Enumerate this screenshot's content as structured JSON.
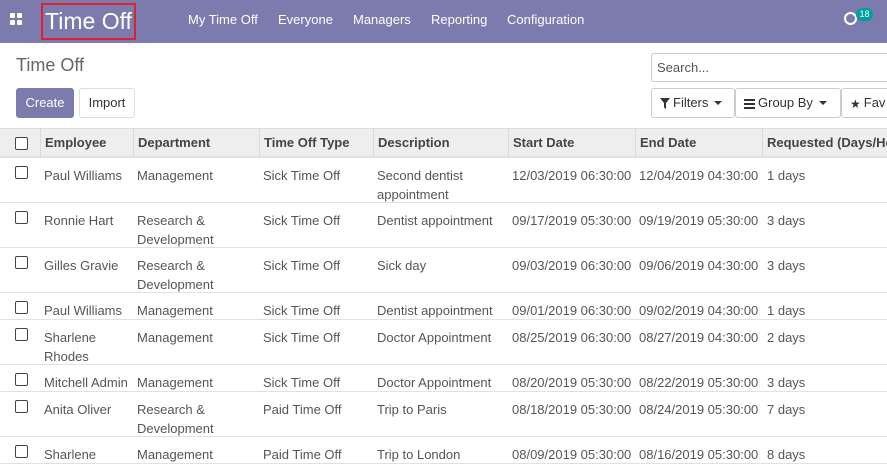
{
  "navbar": {
    "brand": "Time Off",
    "menu": [
      "My Time Off",
      "Everyone",
      "Managers",
      "Reporting",
      "Configuration"
    ],
    "activity_count": "18",
    "color": "#7c7bad"
  },
  "control_panel": {
    "title": "Time Off",
    "create_label": "Create",
    "import_label": "Import",
    "search_placeholder": "Search...",
    "filters_label": "Filters",
    "groupby_label": "Group By",
    "favorites_label": "Fav"
  },
  "table": {
    "columns": [
      "Employee",
      "Department",
      "Time Off Type",
      "Description",
      "Start Date",
      "End Date",
      "Requested (Days/Ho"
    ],
    "rows": [
      {
        "employee": [
          "Paul Williams"
        ],
        "department": [
          "Management"
        ],
        "type": "Sick Time Off",
        "description": [
          "Second dentist",
          "appointment"
        ],
        "start": "12/03/2019 06:30:00",
        "end": "12/04/2019 04:30:00",
        "requested": "1 days"
      },
      {
        "employee": [
          "Ronnie Hart"
        ],
        "department": [
          "Research &",
          "Development"
        ],
        "type": "Sick Time Off",
        "description": [
          "Dentist appointment"
        ],
        "start": "09/17/2019 05:30:00",
        "end": "09/19/2019 05:30:00",
        "requested": "3 days"
      },
      {
        "employee": [
          "Gilles Gravie"
        ],
        "department": [
          "Research &",
          "Development"
        ],
        "type": "Sick Time Off",
        "description": [
          "Sick day"
        ],
        "start": "09/03/2019 06:30:00",
        "end": "09/06/2019 04:30:00",
        "requested": "3 days"
      },
      {
        "employee": [
          "Paul Williams"
        ],
        "department": [
          "Management"
        ],
        "type": "Sick Time Off",
        "description": [
          "Dentist appointment"
        ],
        "start": "09/01/2019 06:30:00",
        "end": "09/02/2019 04:30:00",
        "requested": "1 days"
      },
      {
        "employee": [
          "Sharlene",
          "Rhodes"
        ],
        "department": [
          "Management"
        ],
        "type": "Sick Time Off",
        "description": [
          "Doctor Appointment"
        ],
        "start": "08/25/2019 06:30:00",
        "end": "08/27/2019 04:30:00",
        "requested": "2 days"
      },
      {
        "employee": [
          "Mitchell Admin"
        ],
        "department": [
          "Management"
        ],
        "type": "Sick Time Off",
        "description": [
          "Doctor Appointment"
        ],
        "start": "08/20/2019 05:30:00",
        "end": "08/22/2019 05:30:00",
        "requested": "3 days"
      },
      {
        "employee": [
          "Anita Oliver"
        ],
        "department": [
          "Research &",
          "Development"
        ],
        "type": "Paid Time Off",
        "description": [
          "Trip to Paris"
        ],
        "start": "08/18/2019 05:30:00",
        "end": "08/24/2019 05:30:00",
        "requested": "7 days"
      },
      {
        "employee": [
          "Sharlene"
        ],
        "department": [
          "Management"
        ],
        "type": "Paid Time Off",
        "description": [
          "Trip to London"
        ],
        "start": "08/09/2019 05:30:00",
        "end": "08/16/2019 05:30:00",
        "requested": "8 days"
      }
    ]
  },
  "icons": {
    "apps": "apps-grid-icon",
    "activity": "activity-clock-icon",
    "filter": "filter-icon",
    "groupby": "list-bars-icon",
    "favorites": "star-icon"
  }
}
